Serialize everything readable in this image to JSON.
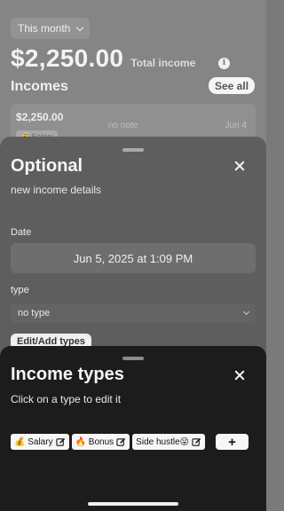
{
  "summary": {
    "period_label": "This month",
    "total_amount": "$2,250.00",
    "total_label": "Total income",
    "info_glyph": "i"
  },
  "incomes": {
    "title": "Incomes",
    "see_all_label": "See all",
    "items": [
      {
        "amount": "$2,250.00",
        "note": "no note",
        "date": "Jun 4",
        "tag_emoji": "💰",
        "tag_label": "Salary"
      }
    ]
  },
  "optional_sheet": {
    "title": "Optional",
    "subtitle": "new income details",
    "date_label": "Date",
    "date_value": "Jun 5, 2025 at 1:09 PM",
    "type_label": "type",
    "type_value": "no type",
    "edit_types_label": "Edit/Add types"
  },
  "types_sheet": {
    "title": "Income types",
    "subtitle": "Click on a type to edit it",
    "types": [
      {
        "label": "💰 Salary"
      },
      {
        "label": "🔥 Bonus"
      },
      {
        "label": "Side hustle😜"
      }
    ],
    "add_label": "+"
  },
  "icons": [
    "chevron-down-icon",
    "info-icon",
    "close-icon",
    "edit-icon",
    "plus-icon"
  ],
  "colors": {
    "types_sheet_bg": "#1c1c1c",
    "optional_sheet_bg": "#5e5e5e",
    "chip_bg": "#f7f7f7"
  }
}
